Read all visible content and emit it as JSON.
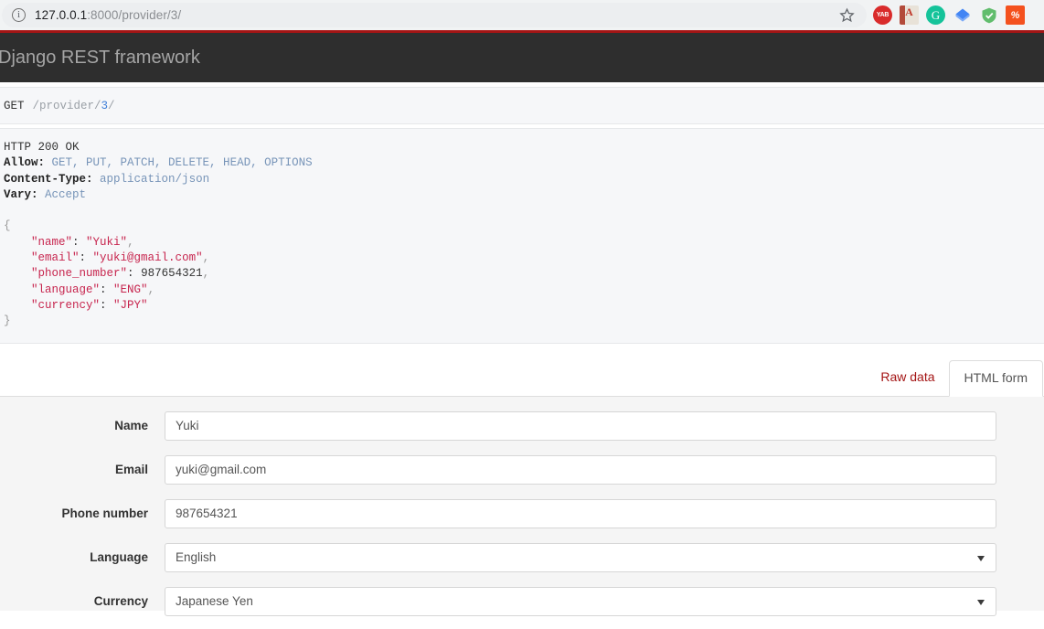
{
  "browser": {
    "url_host": "127.0.0.1",
    "url_rest": ":8000/provider/3/",
    "info_glyph": "i",
    "extensions": [
      "YAB",
      "A",
      "G",
      "",
      "",
      "%"
    ]
  },
  "navbar": {
    "brand": "Django REST framework"
  },
  "request": {
    "method": "GET",
    "path": "/provider/",
    "path_id": "3",
    "path_tail": "/"
  },
  "response": {
    "status_line": "HTTP 200 OK",
    "headers": [
      {
        "name": "Allow:",
        "value": "GET, PUT, PATCH, DELETE, HEAD, OPTIONS"
      },
      {
        "name": "Content-Type:",
        "value": "application/json"
      },
      {
        "name": "Vary:",
        "value": "Accept"
      }
    ],
    "json": {
      "open_brace": "{",
      "close_brace": "}",
      "entries": [
        {
          "key": "\"name\"",
          "sep": ": ",
          "value": "\"Yuki\"",
          "type": "string",
          "comma": ","
        },
        {
          "key": "\"email\"",
          "sep": ": ",
          "value": "\"yuki@gmail.com\"",
          "type": "string",
          "comma": ","
        },
        {
          "key": "\"phone_number\"",
          "sep": ": ",
          "value": "987654321",
          "type": "number",
          "comma": ","
        },
        {
          "key": "\"language\"",
          "sep": ": ",
          "value": "\"ENG\"",
          "type": "string",
          "comma": ","
        },
        {
          "key": "\"currency\"",
          "sep": ": ",
          "value": "\"JPY\"",
          "type": "string",
          "comma": ""
        }
      ]
    }
  },
  "tabs": {
    "raw_data": "Raw data",
    "html_form": "HTML form",
    "active": "HTML form"
  },
  "form": {
    "fields": [
      {
        "label": "Name",
        "value": "Yuki",
        "type": "text"
      },
      {
        "label": "Email",
        "value": "yuki@gmail.com",
        "type": "text"
      },
      {
        "label": "Phone number",
        "value": "987654321",
        "type": "text"
      },
      {
        "label": "Language",
        "value": "English",
        "type": "select"
      },
      {
        "label": "Currency",
        "value": "Japanese Yen",
        "type": "select"
      }
    ]
  },
  "colors": {
    "brand_red": "#a41515",
    "navbar_bg": "#2e2e2e",
    "json_pink": "#c7254e",
    "header_blue": "#7794b8",
    "form_bg": "#f5f5f5"
  }
}
